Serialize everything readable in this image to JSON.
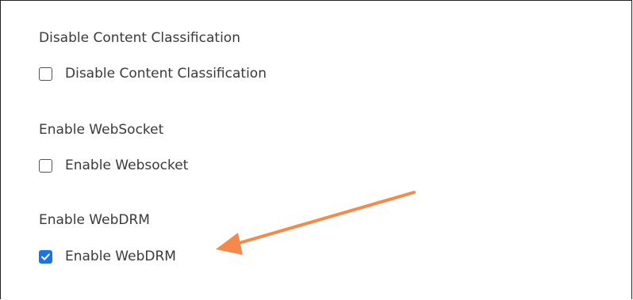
{
  "settings": [
    {
      "title": "Disable Content Classification",
      "checkbox_label": "Disable Content Classification",
      "checked": false
    },
    {
      "title": "Enable WebSocket",
      "checkbox_label": "Enable Websocket",
      "checked": false
    },
    {
      "title": "Enable WebDRM",
      "checkbox_label": "Enable WebDRM",
      "checked": true
    }
  ],
  "colors": {
    "checkbox_checked": "#1a73e8",
    "annotation_arrow": "#f5894a",
    "text": "#3a3a3a"
  },
  "annotation": {
    "icon": "arrow-pointer-icon",
    "points_to": "Enable WebDRM"
  }
}
